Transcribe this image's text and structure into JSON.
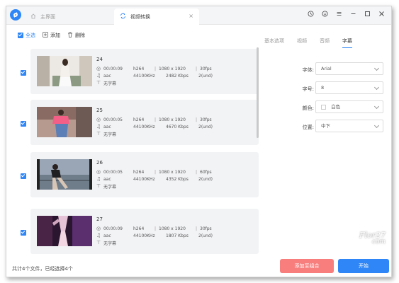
{
  "titlebar": {
    "tabs": [
      {
        "label": "主界面",
        "icon": "home-icon"
      },
      {
        "label": "视频转换",
        "icon": "convert-icon"
      }
    ],
    "close_glyph": "×",
    "controls": [
      "clock-icon",
      "smiley-icon",
      "menu-icon",
      "minimize-icon",
      "maximize-icon",
      "close-icon"
    ]
  },
  "toolbar": {
    "select_all": "全选",
    "add": "添加",
    "delete": "删除"
  },
  "files": [
    {
      "name": "24",
      "duration": "00:00:09",
      "vcodec": "h264",
      "resolution": "1080 x 1920",
      "fps": "30fps",
      "acodec": "aac",
      "samplerate": "44100KHz",
      "bitrate": "2482 Kbps",
      "channels": "2(und)",
      "subtitle": "无字幕"
    },
    {
      "name": "25",
      "duration": "00:00:05",
      "vcodec": "h264",
      "resolution": "1080 x 1920",
      "fps": "30fps",
      "acodec": "aac",
      "samplerate": "44100KHz",
      "bitrate": "4670 Kbps",
      "channels": "2(und)",
      "subtitle": "无字幕"
    },
    {
      "name": "26",
      "duration": "00:00:05",
      "vcodec": "h264",
      "resolution": "1080 x 1920",
      "fps": "60fps",
      "acodec": "aac",
      "samplerate": "44100KHz",
      "bitrate": "4352 Kbps",
      "channels": "2(und)",
      "subtitle": "无字幕"
    },
    {
      "name": "27",
      "duration": "00:00:09",
      "vcodec": "h264",
      "resolution": "1080 x 1920",
      "fps": "30fps",
      "acodec": "aac",
      "samplerate": "44100KHz",
      "bitrate": "1807 Kbps",
      "channels": "2(und)",
      "subtitle": "无字幕"
    }
  ],
  "right_tabs": [
    "基本选项",
    "视频",
    "音频",
    "字幕"
  ],
  "active_right_tab": "字幕",
  "subtitle_settings": {
    "font_label": "字体:",
    "font_value": "Arial",
    "size_label": "字号:",
    "size_value": "8",
    "color_label": "颜色:",
    "color_value": "白色",
    "position_label": "位置:",
    "position_value": "中下"
  },
  "footer": {
    "summary": "共计4个文件，已经选择4个",
    "add_to_group": "添加至组合",
    "start": "开始"
  },
  "watermark": {
    "line1": "Flor27",
    "line2": "com"
  },
  "colors": {
    "accent": "#2f86f6",
    "danger": "#f87e7e",
    "card": "#f2f3f5"
  }
}
